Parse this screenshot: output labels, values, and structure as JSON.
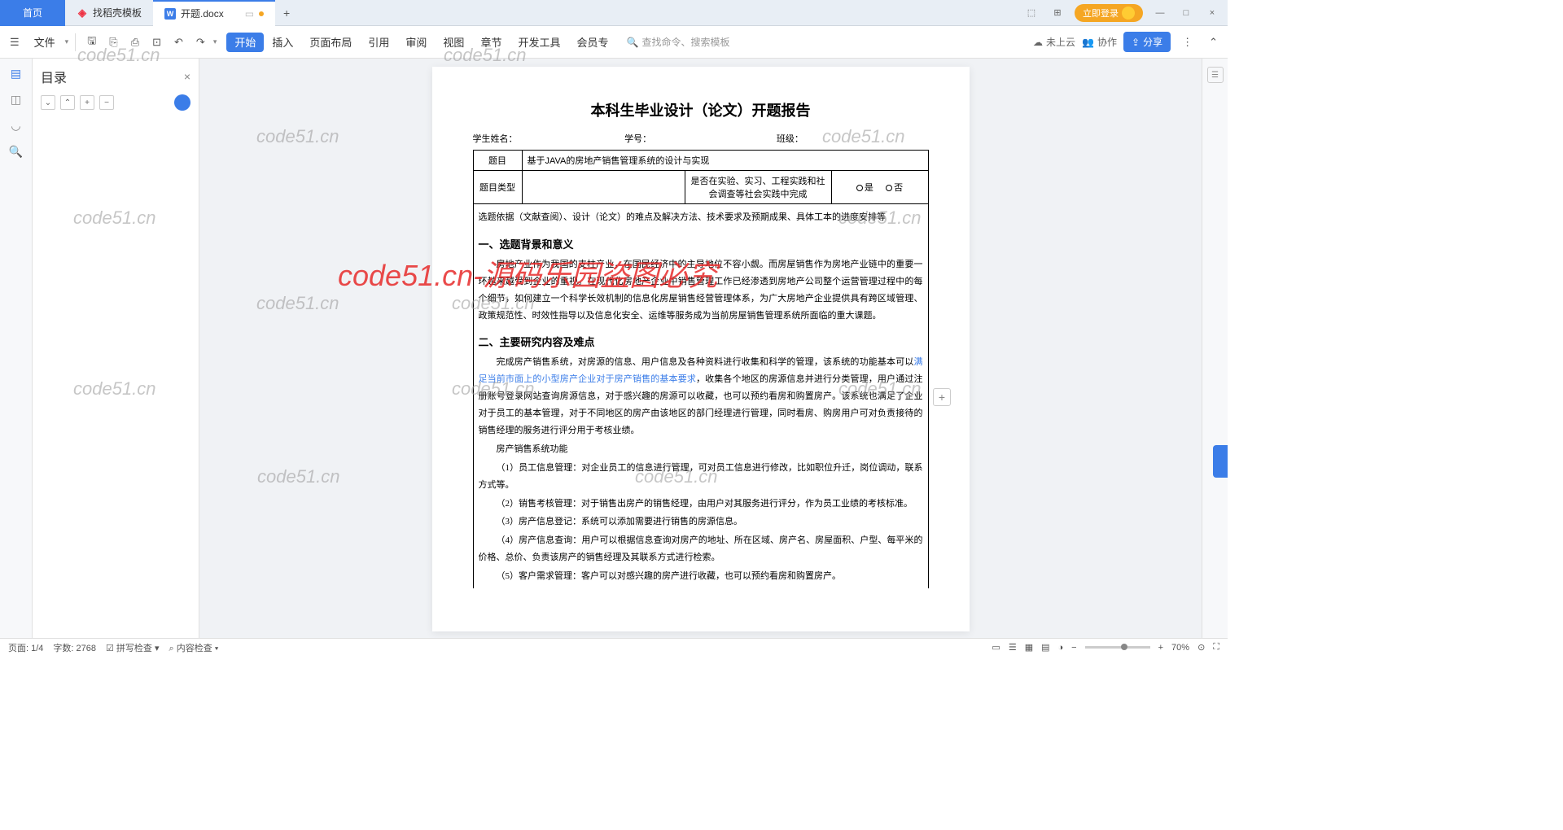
{
  "tabs": {
    "home": "首页",
    "t1": "找稻壳模板",
    "t2": "开题.docx",
    "add": "+"
  },
  "titlebar": {
    "login": "立即登录",
    "min": "—",
    "max": "□",
    "close": "×",
    "sq1": "⬚",
    "sq2": "⊞"
  },
  "toolbar": {
    "file": "文件",
    "menu": {
      "start": "开始",
      "insert": "插入",
      "layout": "页面布局",
      "ref": "引用",
      "review": "审阅",
      "view": "视图",
      "chapter": "章节",
      "dev": "开发工具",
      "member": "会员专"
    },
    "search_placeholder": "查找命令、搜索模板",
    "cloud": "未上云",
    "collab": "协作",
    "share": "分享"
  },
  "outline": {
    "title": "目录",
    "close": "×"
  },
  "doc": {
    "title": "本科生毕业设计（论文）开题报告",
    "info": {
      "name_l": "学生姓名：",
      "id_l": "学号：",
      "class_l": "班级："
    },
    "row_topic_l": "题目",
    "row_topic_v": "基于JAVA的房地产销售管理系统的设计与实现",
    "row_type_l": "题目类型",
    "row_type_v": "是否在实验、实习、工程实践和社会调查等社会实践中完成",
    "yes": "是",
    "no": "否",
    "basis": "选题依据（文献查阅）、设计（论文）的难点及解决方法、技术要求及预期成果、具体工本的进度安排等",
    "h1": "一、选题背景和意义",
    "p1": "房地产业作为我国的支柱产业，在国民经济中的主导地位不容小觑。而房屋销售作为房地产业链中的重要一环越来越受到企业的重视。在现代化房地产企业中销售管理工作已经渗透到房地产公司整个运营管理过程中的每个细节，如何建立一个科学长效机制的信息化房屋销售经营管理体系，为广大房地产企业提供具有跨区域管理、政策规范性、时效性指导以及信息化安全、运维等服务成为当前房屋销售管理系统所面临的重大课题。",
    "h2": "二、主要研究内容及难点",
    "p2a": "完成房产销售系统，对房源的信息、用户信息及各种资料进行收集和科学的管理，该系统的功能基本可以",
    "p2link": "满足当前市面上的小型房产企业对于房产销售的基本要求",
    "p2b": "，收集各个地区的房源信息并进行分类管理，用户通过注册账号登录网站查询房源信息，对于感兴趣的房源可以收藏，也可以预约看房和购置房产。该系统也满足了企业对于员工的基本管理，对于不同地区的房产由该地区的部门经理进行管理，同时看房、购房用户可对负责接待的销售经理的服务进行评分用于考核业绩。",
    "fns_h": "房产销售系统功能",
    "fn1": "（1）员工信息管理：对企业员工的信息进行管理，可对员工信息进行修改，比如职位升迁，岗位调动，联系方式等。",
    "fn2": "（2）销售考核管理：对于销售出房产的销售经理，由用户对其服务进行评分，作为员工业绩的考核标准。",
    "fn3": "（3）房产信息登记：系统可以添加需要进行销售的房源信息。",
    "fn4": "（4）房产信息查询：用户可以根据信息查询对房产的地址、所在区域、房产名、房屋面积、户型、每平米的价格、总价、负责该房产的销售经理及其联系方式进行检索。",
    "fn5": "（5）客户需求管理：客户可以对感兴趣的房产进行收藏，也可以预约看房和购置房产。"
  },
  "status": {
    "page": "页面: 1/4",
    "words": "字数: 2768",
    "spell": "拼写检查",
    "content": "内容检查",
    "zoom": "70%"
  },
  "watermark": "code51.cn",
  "watermark_big": "code51.cn-源码乐园盗图必究"
}
